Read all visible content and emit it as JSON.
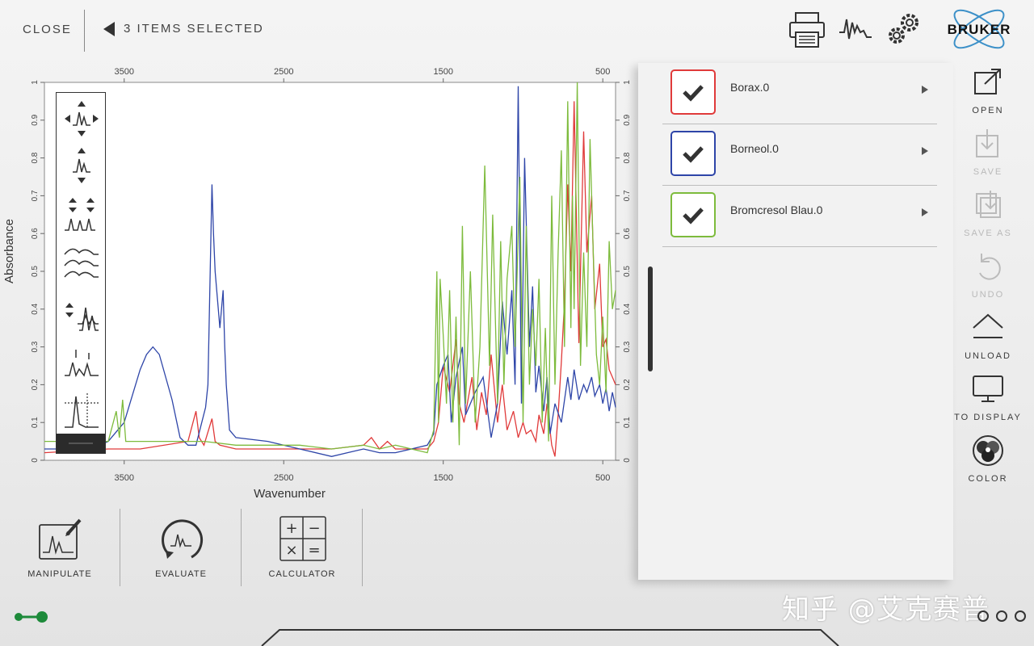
{
  "header": {
    "close_label": "CLOSE",
    "selection_label": "3 ITEMS SELECTED",
    "brand": "BRUKER"
  },
  "chart_data": {
    "type": "line",
    "xlabel": "Wavenumber",
    "ylabel": "Absorbance",
    "xlim": [
      4000,
      420
    ],
    "ylim": [
      0,
      1.0
    ],
    "x_ticks": [
      3500,
      2500,
      1500,
      500
    ],
    "y_ticks": [
      0,
      0.1,
      0.2,
      0.3,
      0.4,
      0.5,
      0.6,
      0.7,
      0.8,
      0.9,
      1
    ],
    "series": [
      {
        "name": "Borax.0",
        "color": "#e03a3a",
        "x": [
          4000,
          3600,
          3400,
          3100,
          3050,
          3030,
          3000,
          2950,
          2930,
          2900,
          2800,
          2600,
          2400,
          2200,
          2000,
          1950,
          1900,
          1850,
          1800,
          1700,
          1600,
          1560,
          1530,
          1500,
          1460,
          1420,
          1400,
          1370,
          1320,
          1290,
          1260,
          1230,
          1200,
          1160,
          1130,
          1100,
          1060,
          1030,
          1000,
          980,
          950,
          920,
          900,
          870,
          850,
          820,
          800,
          780,
          760,
          740,
          720,
          700,
          680,
          650,
          620,
          600,
          570,
          550,
          520,
          500,
          480,
          460,
          440,
          420
        ],
        "y": [
          0.02,
          0.03,
          0.03,
          0.05,
          0.13,
          0.06,
          0.04,
          0.11,
          0.05,
          0.04,
          0.03,
          0.03,
          0.03,
          0.03,
          0.04,
          0.06,
          0.03,
          0.05,
          0.03,
          0.03,
          0.03,
          0.05,
          0.1,
          0.25,
          0.18,
          0.32,
          0.15,
          0.1,
          0.22,
          0.08,
          0.18,
          0.12,
          0.28,
          0.1,
          0.2,
          0.08,
          0.13,
          0.06,
          0.1,
          0.07,
          0.08,
          0.05,
          0.12,
          0.07,
          0.15,
          0.04,
          0.01,
          0.12,
          0.26,
          0.42,
          0.73,
          0.5,
          0.95,
          0.31,
          0.87,
          0.55,
          0.7,
          0.4,
          0.52,
          0.3,
          0.32,
          0.24,
          0.22,
          0.2
        ]
      },
      {
        "name": "Borneol.0",
        "color": "#2e45a8",
        "x": [
          4000,
          3700,
          3600,
          3500,
          3450,
          3400,
          3360,
          3320,
          3280,
          3200,
          3150,
          3100,
          3050,
          2990,
          2975,
          2960,
          2950,
          2940,
          2930,
          2900,
          2880,
          2870,
          2860,
          2840,
          2800,
          2600,
          2400,
          2200,
          2100,
          2000,
          1900,
          1800,
          1700,
          1600,
          1560,
          1540,
          1500,
          1470,
          1450,
          1420,
          1380,
          1360,
          1300,
          1250,
          1200,
          1160,
          1130,
          1100,
          1070,
          1050,
          1030,
          1010,
          990,
          960,
          940,
          920,
          900,
          870,
          850,
          830,
          800,
          760,
          720,
          700,
          680,
          650,
          620,
          600,
          570,
          550,
          520,
          500,
          480,
          460,
          440,
          420
        ],
        "y": [
          0.03,
          0.03,
          0.05,
          0.1,
          0.17,
          0.24,
          0.28,
          0.3,
          0.28,
          0.16,
          0.06,
          0.04,
          0.04,
          0.14,
          0.2,
          0.52,
          0.73,
          0.6,
          0.5,
          0.35,
          0.45,
          0.3,
          0.2,
          0.08,
          0.06,
          0.05,
          0.03,
          0.01,
          0.02,
          0.03,
          0.02,
          0.02,
          0.03,
          0.04,
          0.07,
          0.2,
          0.25,
          0.28,
          0.1,
          0.22,
          0.3,
          0.12,
          0.18,
          0.22,
          0.06,
          0.15,
          0.42,
          0.28,
          0.45,
          0.2,
          0.99,
          0.15,
          0.8,
          0.3,
          0.46,
          0.18,
          0.25,
          0.13,
          0.22,
          0.07,
          0.15,
          0.1,
          0.22,
          0.16,
          0.24,
          0.16,
          0.2,
          0.18,
          0.22,
          0.17,
          0.2,
          0.15,
          0.19,
          0.13,
          0.18,
          0.14
        ]
      },
      {
        "name": "Bromcresol Blau.0",
        "color": "#7dbb3c",
        "x": [
          4000,
          3600,
          3550,
          3530,
          3510,
          3490,
          3470,
          3400,
          3200,
          3000,
          2800,
          2600,
          2400,
          2200,
          2000,
          1900,
          1800,
          1700,
          1600,
          1560,
          1540,
          1530,
          1520,
          1500,
          1480,
          1460,
          1440,
          1420,
          1400,
          1380,
          1360,
          1330,
          1300,
          1270,
          1240,
          1210,
          1190,
          1160,
          1140,
          1120,
          1100,
          1070,
          1050,
          1020,
          1000,
          980,
          960,
          940,
          920,
          900,
          880,
          860,
          840,
          820,
          800,
          780,
          760,
          740,
          720,
          700,
          690,
          680,
          660,
          640,
          620,
          600,
          580,
          560,
          540,
          520,
          500,
          480,
          460,
          440,
          420
        ],
        "y": [
          0.05,
          0.05,
          0.13,
          0.06,
          0.16,
          0.05,
          0.05,
          0.05,
          0.05,
          0.05,
          0.04,
          0.04,
          0.04,
          0.03,
          0.04,
          0.03,
          0.04,
          0.03,
          0.02,
          0.08,
          0.5,
          0.1,
          0.48,
          0.33,
          0.15,
          0.45,
          0.1,
          0.38,
          0.04,
          0.62,
          0.15,
          0.5,
          0.1,
          0.3,
          0.78,
          0.25,
          0.65,
          0.15,
          0.58,
          0.2,
          0.48,
          0.62,
          0.3,
          0.75,
          0.1,
          0.62,
          0.2,
          0.4,
          0.25,
          0.48,
          0.1,
          0.35,
          0.05,
          0.7,
          0.2,
          0.55,
          0.82,
          0.3,
          0.95,
          0.35,
          0.7,
          0.4,
          1.0,
          0.25,
          0.55,
          0.3,
          0.85,
          0.55,
          0.28,
          0.2,
          0.38,
          0.18,
          0.58,
          0.4,
          0.45
        ]
      }
    ]
  },
  "spectra_list": [
    {
      "name": "Borax.0",
      "color": "#e03a3a"
    },
    {
      "name": "Borneol.0",
      "color": "#2e45a8"
    },
    {
      "name": "Bromcresol Blau.0",
      "color": "#7dbb3c"
    }
  ],
  "sidebar": {
    "open": "OPEN",
    "save": "SAVE",
    "save_as": "SAVE AS",
    "undo": "UNDO",
    "unload": "UNLOAD",
    "to_display": "TO DISPLAY",
    "color": "COLOR"
  },
  "bottom_tools": {
    "manipulate": "MANIPULATE",
    "evaluate": "EVALUATE",
    "calculator": "CALCULATOR"
  },
  "watermark": "知乎 @艾克赛普"
}
